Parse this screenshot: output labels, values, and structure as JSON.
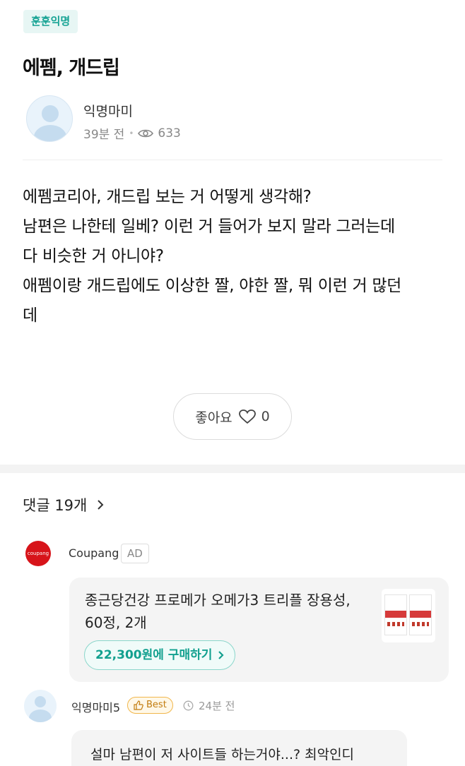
{
  "category": "훈훈익명",
  "post": {
    "title": "에펨, 개드립",
    "author": "익명마미",
    "time": "39분 전",
    "views": "633",
    "content_lines": [
      "에펨코리아, 개드립 보는 거 어떻게 생각해?",
      "남편은 나한테 일베? 이런 거 들어가 보지 말라 그러는데",
      "다 비슷한 거 아니야?",
      "애펨이랑 개드립에도 이상한 짤, 야한 짤, 뭐 이런 거 많던",
      "데"
    ],
    "like_label": "좋아요",
    "like_count": "0"
  },
  "comments_header": "댓글 19개",
  "ad": {
    "logo_text": "coupang",
    "advertiser": "Coupang",
    "tag": "AD",
    "text_lines": [
      "종근당건강 프로메가 오메가3 트리플 장용성,",
      "60정, 2개"
    ],
    "price_button": "22,300원에 구매하기"
  },
  "comment": {
    "author": "익명마미5",
    "badge": "Best",
    "time": "24분 전",
    "text": "설마 남편이 저 사이트들 하는거야...? 최악인디"
  },
  "icons": {
    "eye": "eye-icon",
    "heart": "heart-icon",
    "chevron": "chevron-right-icon",
    "thumb": "thumbs-up-icon",
    "clock": "clock-icon"
  },
  "colors": {
    "accent": "#16a394",
    "coupang": "#d7141a",
    "best": "#f1b64a"
  }
}
